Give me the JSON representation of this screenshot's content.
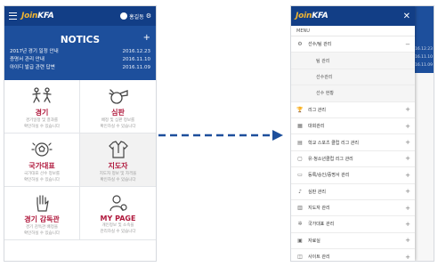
{
  "app": {
    "logo_prefix": "Join",
    "logo_suffix": "KFA",
    "username": "홍길동"
  },
  "notices": {
    "title": "NOTICS",
    "plus": "+",
    "items": [
      {
        "text": "2017년 경기 일정 안내",
        "date": "2016.12.23"
      },
      {
        "text": "증명서 관리 안내",
        "date": "2016.11.10"
      },
      {
        "text": "아이디 발급 관련 답변",
        "date": "2016.11.09"
      }
    ]
  },
  "tiles": [
    {
      "title": "경기",
      "desc1": "경기일정 및 결과를",
      "desc2": "확인하실 수 있습니다",
      "icon": "players-icon"
    },
    {
      "title": "심판",
      "desc1": "배정 및 심판 정보를",
      "desc2": "확인하실 수 있습니다",
      "icon": "whistle-icon"
    },
    {
      "title": "국가대표",
      "desc1": "국가대표 선수 정보를",
      "desc2": "확인하실 수 있습니다",
      "icon": "soccer-ball-icon"
    },
    {
      "title": "지도자",
      "desc1": "지도자 정보 및 자격을",
      "desc2": "확인하실 수 있습니다",
      "icon": "coach-shirt-icon"
    },
    {
      "title": "경기 감독관",
      "desc1": "경기 감독관 배정을",
      "desc2": "확인하실 수 있습니다",
      "icon": "raised-hand-icon"
    },
    {
      "title": "MY PAGE",
      "desc1": "개인정보 및 소속을",
      "desc2": "관리하실 수 있습니다",
      "icon": "user-settings-icon"
    }
  ],
  "drawer": {
    "close": "✕",
    "menu_label": "MENU",
    "expanded": {
      "icon": "gear-icon",
      "label": "선수/팀 관리",
      "toggle": "−"
    },
    "sub_items": [
      "팀 관리",
      "선수관리",
      "선수 현황"
    ],
    "items": [
      {
        "icon": "trophy-icon",
        "label": "리그 관리",
        "toggle": "+"
      },
      {
        "icon": "calendar-icon",
        "label": "대회관리",
        "toggle": "+"
      },
      {
        "icon": "document-icon",
        "label": "학교 스포츠 클럽 리그 관리",
        "toggle": "+"
      },
      {
        "icon": "clipboard-icon",
        "label": "유·청소년클럽 리그 관리",
        "toggle": "+"
      },
      {
        "icon": "folder-icon",
        "label": "등록/승인/증명서 관리",
        "toggle": "+"
      },
      {
        "icon": "whistle-icon",
        "label": "심판 관리",
        "toggle": "+"
      },
      {
        "icon": "coach-icon",
        "label": "지도자 관리",
        "toggle": "+"
      },
      {
        "icon": "national-icon",
        "label": "국가대표 관리",
        "toggle": "+"
      },
      {
        "icon": "library-icon",
        "label": "자료실",
        "toggle": "+"
      },
      {
        "icon": "site-icon",
        "label": "사이트 관리",
        "toggle": "+"
      }
    ]
  },
  "background": {
    "dates": [
      "16.12.23",
      "16.11.10",
      "16.11.09"
    ]
  },
  "colors": {
    "primary": "#123e86",
    "notice_bg": "#1d4f9c",
    "accent": "#b0193d",
    "logo_accent": "#f2b531",
    "arrow": "#1d4f9c"
  }
}
